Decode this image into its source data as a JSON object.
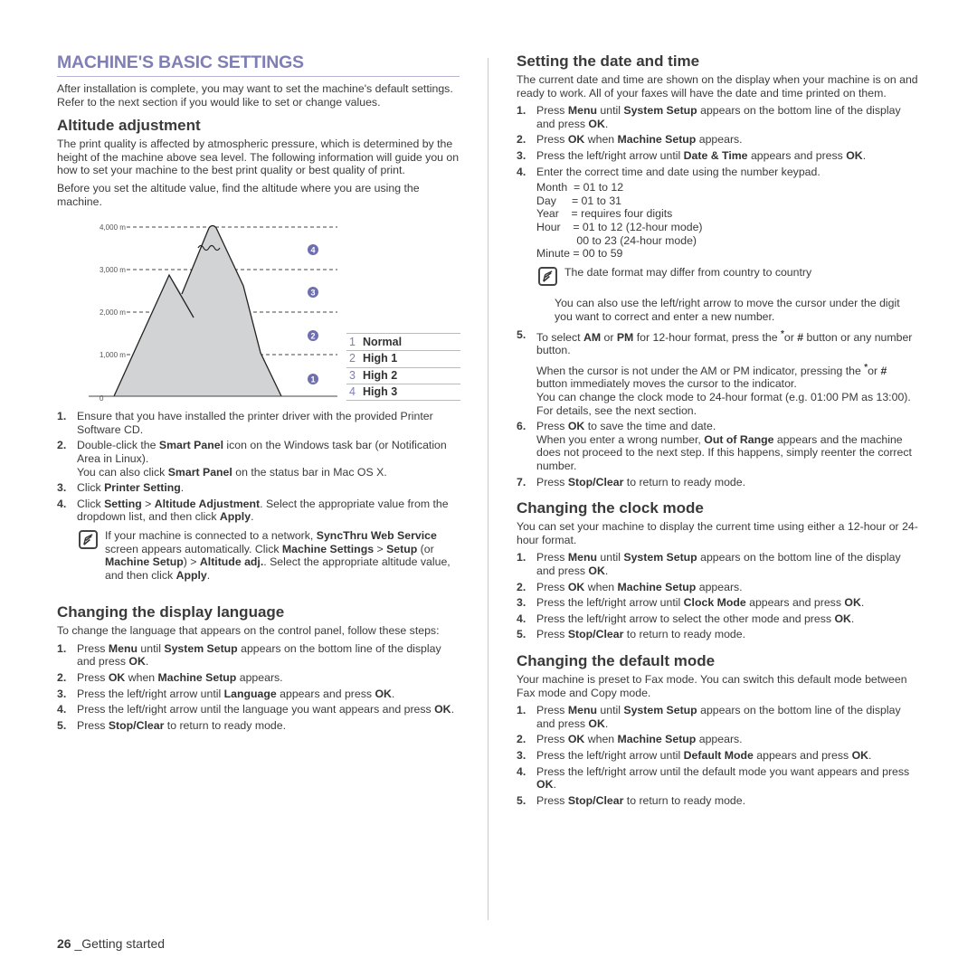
{
  "page": {
    "title": "MACHINE'S BASIC SETTINGS",
    "intro": "After installation is complete, you may want to set the machine's default settings. Refer to the next section if you would like to set or change values.",
    "footer_page_number": "26",
    "footer_section": "_Getting started",
    "accent_color": "#7f7fb5"
  },
  "altitude": {
    "heading": "Altitude adjustment",
    "para1": "The print quality is affected by atmospheric pressure, which is determined by the height of the machine above sea level. The following information will guide you on how to set your machine to the best print quality or best quality of print.",
    "para2": "Before you set the altitude value, find the altitude where you are using the machine.",
    "figure": {
      "axis_labels": [
        "4,000 m",
        "3,000 m",
        "2,000 m",
        "1,000 m",
        "0"
      ],
      "zone_badges": [
        "4",
        "3",
        "2",
        "1"
      ],
      "legend": [
        {
          "num": "1",
          "label": "Normal"
        },
        {
          "num": "2",
          "label": "High 1"
        },
        {
          "num": "3",
          "label": "High 2"
        },
        {
          "num": "4",
          "label": "High 3"
        }
      ]
    },
    "steps": [
      {
        "num": "1.",
        "parts": [
          [
            "t",
            "Ensure that you have installed the printer driver with the provided Printer Software CD."
          ]
        ]
      },
      {
        "num": "2.",
        "parts": [
          [
            "t",
            "Double-click the "
          ],
          [
            "b",
            "Smart Panel"
          ],
          [
            "t",
            " icon on the Windows task bar (or Notification Area in Linux)."
          ],
          [
            "br",
            ""
          ],
          [
            "t",
            "You can also click "
          ],
          [
            "b",
            "Smart Panel"
          ],
          [
            "t",
            " on the status bar in Mac OS X."
          ]
        ]
      },
      {
        "num": "3.",
        "parts": [
          [
            "t",
            "Click "
          ],
          [
            "b",
            "Printer Setting"
          ],
          [
            "t",
            "."
          ]
        ]
      },
      {
        "num": "4.",
        "parts": [
          [
            "t",
            "Click "
          ],
          [
            "b",
            "Setting"
          ],
          [
            "t",
            " > "
          ],
          [
            "b",
            "Altitude Adjustment"
          ],
          [
            "t",
            ". Select the appropriate value from the dropdown list, and then click "
          ],
          [
            "b",
            "Apply"
          ],
          [
            "t",
            "."
          ]
        ]
      }
    ],
    "note": [
      [
        "t",
        "If your machine is connected to a network, "
      ],
      [
        "b",
        "SyncThru Web Service"
      ],
      [
        "t",
        " screen appears automatically. Click "
      ],
      [
        "b",
        "Machine Settings"
      ],
      [
        "t",
        " > "
      ],
      [
        "b",
        "Setup"
      ],
      [
        "t",
        " (or "
      ],
      [
        "b",
        "Machine Setup"
      ],
      [
        "t",
        ") > "
      ],
      [
        "b",
        "Altitude adj."
      ],
      [
        "t",
        ". Select the appropriate altitude value, and then click "
      ],
      [
        "b",
        "Apply"
      ],
      [
        "t",
        "."
      ]
    ]
  },
  "language": {
    "heading": "Changing the display language",
    "intro": "To change the language that appears on the control panel, follow these steps:",
    "steps": [
      {
        "num": "1.",
        "parts": [
          [
            "t",
            "Press "
          ],
          [
            "b",
            "Menu"
          ],
          [
            "t",
            " until "
          ],
          [
            "b",
            "System Setup"
          ],
          [
            "t",
            " appears on the bottom line of the display and press "
          ],
          [
            "b",
            "OK"
          ],
          [
            "t",
            "."
          ]
        ]
      },
      {
        "num": "2.",
        "parts": [
          [
            "t",
            "Press "
          ],
          [
            "b",
            "OK"
          ],
          [
            "t",
            " when "
          ],
          [
            "b",
            "Machine Setup"
          ],
          [
            "t",
            " appears."
          ]
        ]
      },
      {
        "num": "3.",
        "parts": [
          [
            "t",
            "Press the left/right arrow until "
          ],
          [
            "b",
            "Language"
          ],
          [
            "t",
            " appears and press "
          ],
          [
            "b",
            "OK"
          ],
          [
            "t",
            "."
          ]
        ]
      },
      {
        "num": "4.",
        "parts": [
          [
            "t",
            "Press the left/right arrow until the language you want appears and press "
          ],
          [
            "b",
            "OK"
          ],
          [
            "t",
            "."
          ]
        ]
      },
      {
        "num": "5.",
        "parts": [
          [
            "t",
            "Press "
          ],
          [
            "b",
            "Stop/Clear"
          ],
          [
            "t",
            " to return to ready mode."
          ]
        ]
      }
    ]
  },
  "datetime": {
    "heading": "Setting the date and time",
    "intro": "The current date and time are shown on the display when your machine is on and ready to work. All of your faxes will have the date and time printed on them.",
    "steps_a": [
      {
        "num": "1.",
        "parts": [
          [
            "t",
            "Press "
          ],
          [
            "b",
            "Menu"
          ],
          [
            "t",
            " until "
          ],
          [
            "b",
            "System Setup"
          ],
          [
            "t",
            " appears on the bottom line of the display and press "
          ],
          [
            "b",
            "OK"
          ],
          [
            "t",
            "."
          ]
        ]
      },
      {
        "num": "2.",
        "parts": [
          [
            "t",
            "Press "
          ],
          [
            "b",
            "OK"
          ],
          [
            "t",
            " when "
          ],
          [
            "b",
            "Machine Setup"
          ],
          [
            "t",
            " appears."
          ]
        ]
      },
      {
        "num": "3.",
        "parts": [
          [
            "t",
            "Press the left/right arrow until "
          ],
          [
            "b",
            "Date & Time"
          ],
          [
            "t",
            " appears and press "
          ],
          [
            "b",
            "OK"
          ],
          [
            "t",
            "."
          ]
        ]
      },
      {
        "num": "4.",
        "parts": [
          [
            "t",
            "Enter the correct time and date using the number keypad."
          ]
        ]
      }
    ],
    "ranges": [
      "Month  = 01 to 12",
      "Day     = 01 to 31",
      "Year    = requires four digits",
      "Hour    = 01 to 12 (12-hour mode)",
      "             00 to 23 (24-hour mode)",
      "Minute = 00 to 59"
    ],
    "note": "The date format may differ from country to country",
    "cursor_tip": "You can also use the left/right arrow to move the cursor under the digit you want to correct and enter a new number.",
    "steps_b": [
      {
        "num": "5.",
        "parts": [
          [
            "t",
            "To select "
          ],
          [
            "b",
            "AM"
          ],
          [
            "t",
            " or "
          ],
          [
            "b",
            "PM"
          ],
          [
            "t",
            " for 12-hour format, press the "
          ],
          [
            "sup",
            "*"
          ],
          [
            "t",
            "or "
          ],
          [
            "b",
            "#"
          ],
          [
            "t",
            " button or any number button."
          ],
          [
            "gap",
            ""
          ],
          [
            "t",
            "When the cursor is not under the AM or PM indicator, pressing the "
          ],
          [
            "sup",
            "*"
          ],
          [
            "t",
            "or "
          ],
          [
            "b",
            "#"
          ],
          [
            "t",
            " button immediately moves the cursor to the indicator."
          ],
          [
            "br",
            ""
          ],
          [
            "t",
            "You can change the clock mode to 24-hour format (e.g. 01:00 PM as 13:00). For details, see the next section."
          ]
        ]
      },
      {
        "num": "6.",
        "parts": [
          [
            "t",
            "Press "
          ],
          [
            "b",
            "OK"
          ],
          [
            "t",
            " to save the time and date."
          ],
          [
            "br",
            ""
          ],
          [
            "t",
            "When you enter a wrong number, "
          ],
          [
            "b",
            "Out of Range"
          ],
          [
            "t",
            " appears and the machine does not proceed to the next step. If this happens, simply reenter the correct number."
          ]
        ]
      },
      {
        "num": "7.",
        "parts": [
          [
            "t",
            "Press "
          ],
          [
            "b",
            "Stop/Clear"
          ],
          [
            "t",
            " to return to ready mode."
          ]
        ]
      }
    ]
  },
  "clock": {
    "heading": "Changing the clock mode",
    "intro": "You can set your machine to display the current time using either a 12-hour or 24-hour format.",
    "steps": [
      {
        "num": "1.",
        "parts": [
          [
            "t",
            "Press "
          ],
          [
            "b",
            "Menu"
          ],
          [
            "t",
            " until "
          ],
          [
            "b",
            "System Setup"
          ],
          [
            "t",
            " appears on the bottom line of the display and press "
          ],
          [
            "b",
            "OK"
          ],
          [
            "t",
            "."
          ]
        ]
      },
      {
        "num": "2.",
        "parts": [
          [
            "t",
            "Press "
          ],
          [
            "b",
            "OK"
          ],
          [
            "t",
            " when "
          ],
          [
            "b",
            "Machine Setup"
          ],
          [
            "t",
            " appears."
          ]
        ]
      },
      {
        "num": "3.",
        "parts": [
          [
            "t",
            "Press the left/right arrow until "
          ],
          [
            "b",
            "Clock Mode"
          ],
          [
            "t",
            " appears and press "
          ],
          [
            "b",
            "OK"
          ],
          [
            "t",
            "."
          ]
        ]
      },
      {
        "num": "4.",
        "parts": [
          [
            "t",
            "Press the left/right arrow  to select the other mode and press "
          ],
          [
            "b",
            "OK"
          ],
          [
            "t",
            "."
          ]
        ]
      },
      {
        "num": "5.",
        "parts": [
          [
            "t",
            "Press "
          ],
          [
            "b",
            "Stop/Clear"
          ],
          [
            "t",
            " to return to ready mode."
          ]
        ]
      }
    ]
  },
  "defaultmode": {
    "heading": "Changing the default mode",
    "intro": "Your machine is preset to Fax mode. You can switch this default mode between Fax mode and Copy mode.",
    "steps": [
      {
        "num": "1.",
        "parts": [
          [
            "t",
            "Press "
          ],
          [
            "b",
            "Menu"
          ],
          [
            "t",
            " until "
          ],
          [
            "b",
            "System Setup"
          ],
          [
            "t",
            " appears on the bottom line of the display and press "
          ],
          [
            "b",
            "OK"
          ],
          [
            "t",
            "."
          ]
        ]
      },
      {
        "num": "2.",
        "parts": [
          [
            "t",
            "Press "
          ],
          [
            "b",
            "OK"
          ],
          [
            "t",
            " when "
          ],
          [
            "b",
            "Machine Setup"
          ],
          [
            "t",
            " appears."
          ]
        ]
      },
      {
        "num": "3.",
        "parts": [
          [
            "t",
            "Press the left/right arrow until "
          ],
          [
            "b",
            "Default Mode"
          ],
          [
            "t",
            " appears and press "
          ],
          [
            "b",
            "OK"
          ],
          [
            "t",
            "."
          ]
        ]
      },
      {
        "num": "4.",
        "parts": [
          [
            "t",
            "Press the left/right arrow until the default mode you want appears and press "
          ],
          [
            "b",
            "OK"
          ],
          [
            "t",
            "."
          ]
        ]
      },
      {
        "num": "5.",
        "parts": [
          [
            "t",
            "Press "
          ],
          [
            "b",
            "Stop/Clear"
          ],
          [
            "t",
            " to return to ready mode."
          ]
        ]
      }
    ]
  }
}
